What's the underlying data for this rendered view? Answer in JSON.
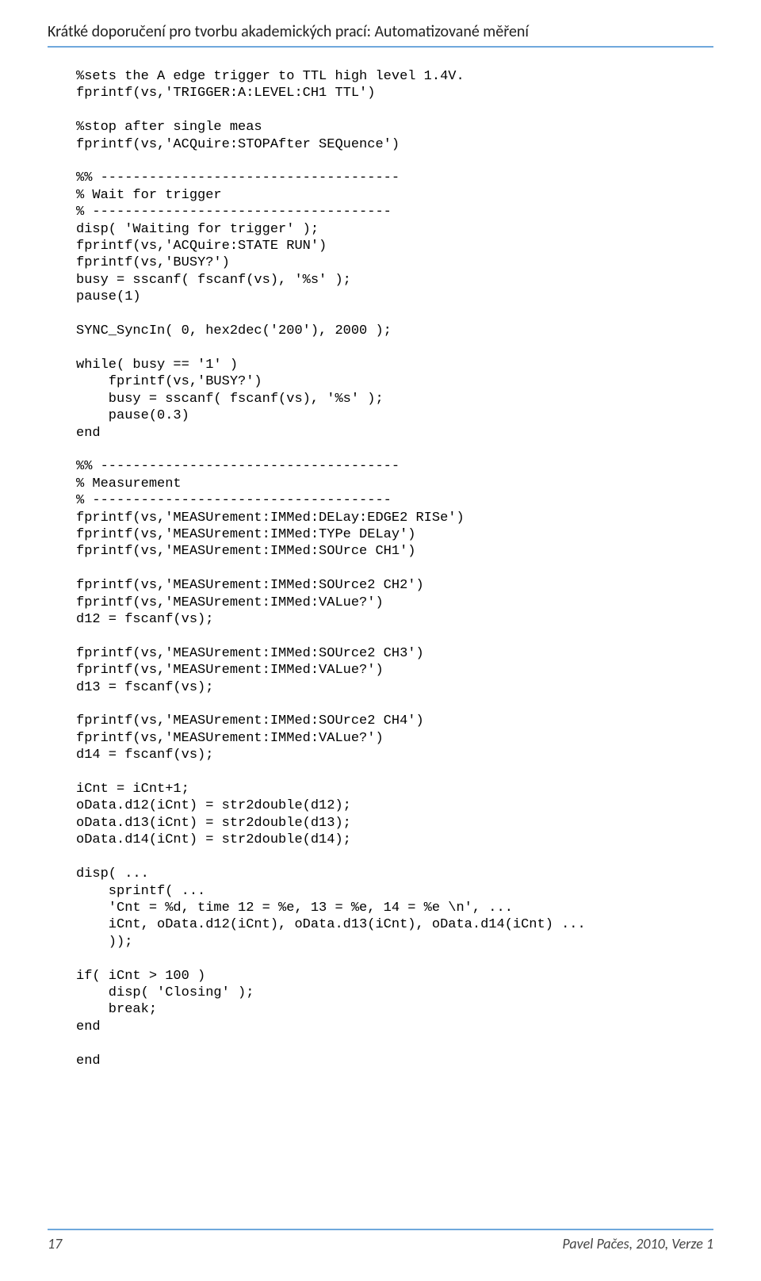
{
  "header": {
    "title": "Krátké doporučení pro tvorbu akademických prací: Automatizované měření"
  },
  "code": {
    "text": "%sets the A edge trigger to TTL high level 1.4V.\nfprintf(vs,'TRIGGER:A:LEVEL:CH1 TTL')\n\n%stop after single meas\nfprintf(vs,'ACQuire:STOPAfter SEQuence')\n\n%% -------------------------------------\n% Wait for trigger\n% -------------------------------------\ndisp( 'Waiting for trigger' );\nfprintf(vs,'ACQuire:STATE RUN')\nfprintf(vs,'BUSY?')\nbusy = sscanf( fscanf(vs), '%s' );\npause(1)\n\nSYNC_SyncIn( 0, hex2dec('200'), 2000 );\n\nwhile( busy == '1' )\n    fprintf(vs,'BUSY?')\n    busy = sscanf( fscanf(vs), '%s' );\n    pause(0.3)\nend\n\n%% -------------------------------------\n% Measurement\n% -------------------------------------\nfprintf(vs,'MEASUrement:IMMed:DELay:EDGE2 RISe')\nfprintf(vs,'MEASUrement:IMMed:TYPe DELay')\nfprintf(vs,'MEASUrement:IMMed:SOUrce CH1')\n\nfprintf(vs,'MEASUrement:IMMed:SOUrce2 CH2')\nfprintf(vs,'MEASUrement:IMMed:VALue?')\nd12 = fscanf(vs);\n\nfprintf(vs,'MEASUrement:IMMed:SOUrce2 CH3')\nfprintf(vs,'MEASUrement:IMMed:VALue?')\nd13 = fscanf(vs);\n\nfprintf(vs,'MEASUrement:IMMed:SOUrce2 CH4')\nfprintf(vs,'MEASUrement:IMMed:VALue?')\nd14 = fscanf(vs);\n\niCnt = iCnt+1;\noData.d12(iCnt) = str2double(d12);\noData.d13(iCnt) = str2double(d13);\noData.d14(iCnt) = str2double(d14);\n\ndisp( ...\n    sprintf( ...\n    'Cnt = %d, time 12 = %e, 13 = %e, 14 = %e \\n', ...\n    iCnt, oData.d12(iCnt), oData.d13(iCnt), oData.d14(iCnt) ...\n    ));\n\nif( iCnt > 100 )\n    disp( 'Closing' );\n    break;\nend\n\nend"
  },
  "footer": {
    "page": "17",
    "credit": "Pavel Pačes, 2010, Verze 1"
  }
}
